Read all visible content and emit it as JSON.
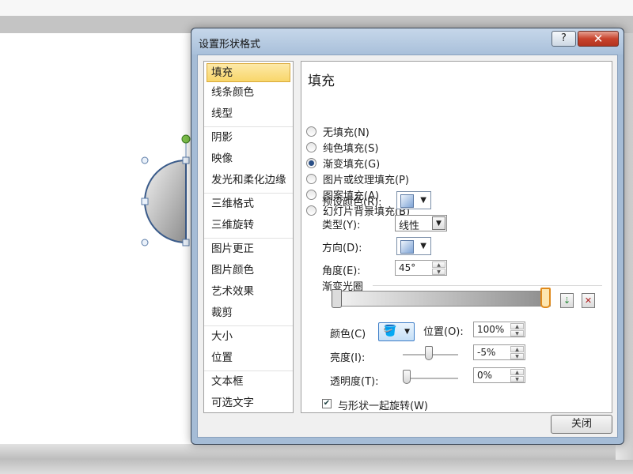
{
  "dialog": {
    "title": "设置形状格式",
    "help_label": "?",
    "close_label": "✕",
    "close_button_label": "关闭"
  },
  "nav": {
    "groups": [
      [
        "填充",
        "线条颜色",
        "线型"
      ],
      [
        "阴影",
        "映像",
        "发光和柔化边缘"
      ],
      [
        "三维格式",
        "三维旋转"
      ],
      [
        "图片更正",
        "图片颜色",
        "艺术效果",
        "裁剪"
      ],
      [
        "大小",
        "位置"
      ],
      [
        "文本框",
        "可选文字"
      ]
    ],
    "selected": "填充"
  },
  "fill": {
    "section_title": "填充",
    "options": [
      {
        "label": "无填充(N)",
        "checked": false
      },
      {
        "label": "纯色填充(S)",
        "checked": false
      },
      {
        "label": "渐变填充(G)",
        "checked": true
      },
      {
        "label": "图片或纹理填充(P)",
        "checked": false
      },
      {
        "label": "图案填充(A)",
        "checked": false
      },
      {
        "label": "幻灯片背景填充(B)",
        "checked": false
      }
    ],
    "preset_label": "预设颜色(R):",
    "type_label": "类型(Y):",
    "type_value": "线性",
    "direction_label": "方向(D):",
    "angle_label": "角度(E):",
    "angle_value": "45°",
    "stops_label": "渐变光圈",
    "color_label": "颜色(C)",
    "position_label": "位置(O):",
    "position_value": "100%",
    "brightness_label": "亮度(I):",
    "brightness_value": "-5%",
    "transparency_label": "透明度(T):",
    "transparency_value": "0%",
    "rotate_label": "与形状一起旋转(W)",
    "rotate_checked": true
  },
  "colors": {
    "accent": "#f8d66a",
    "title_bar": "#a9c0da",
    "close": "#c8432d"
  }
}
